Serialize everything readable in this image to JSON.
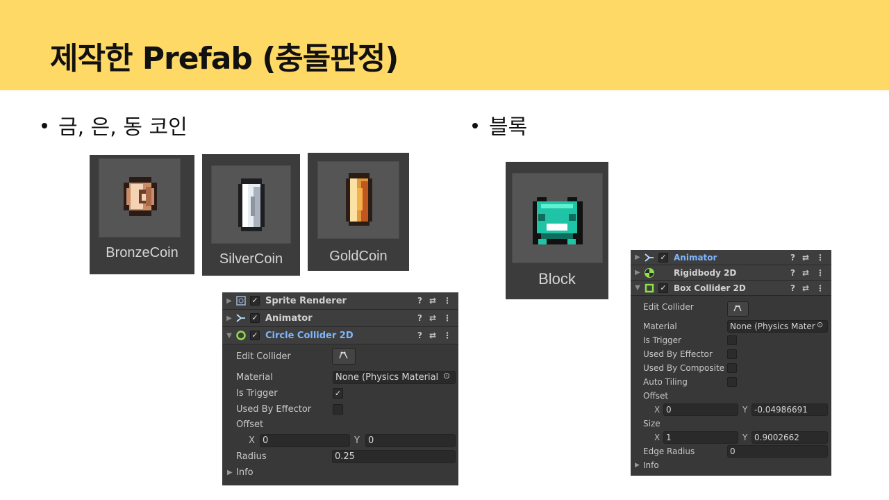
{
  "slide": {
    "title": "제작한 Prefab (충돌판정)",
    "bullet_coins": "금, 은, 동 코인",
    "bullet_block": "블록"
  },
  "prefabs": {
    "bronze": "BronzeCoin",
    "silver": "SilverCoin",
    "gold": "GoldCoin",
    "block": "Block"
  },
  "coin_inspector": {
    "components": [
      {
        "name": "Sprite Renderer",
        "icon": "sprite-renderer-icon",
        "enabled": true,
        "expanded": false
      },
      {
        "name": "Animator",
        "icon": "animator-icon",
        "enabled": true,
        "expanded": false
      },
      {
        "name": "Circle Collider 2D",
        "icon": "circle-collider-icon",
        "enabled": true,
        "expanded": true
      }
    ],
    "tools": [
      "?",
      "⇄",
      "⋮"
    ],
    "edit_collider_label": "Edit Collider",
    "material_label": "Material",
    "material_value": "None (Physics Material",
    "is_trigger_label": "Is Trigger",
    "is_trigger_value": "✓",
    "used_by_effector_label": "Used By Effector",
    "offset_label": "Offset",
    "x_label": "X",
    "y_label": "Y",
    "offset_x": "0",
    "offset_y": "0",
    "radius_label": "Radius",
    "radius_value": "0.25",
    "info_label": "Info"
  },
  "block_inspector": {
    "components": [
      {
        "name": "Animator",
        "icon": "animator-icon",
        "enabled": true,
        "expanded": false
      },
      {
        "name": "Rigidbody 2D",
        "icon": "rigidbody-icon",
        "enabled": null,
        "expanded": false
      },
      {
        "name": "Box Collider 2D",
        "icon": "box-collider-icon",
        "enabled": true,
        "expanded": true
      }
    ],
    "edit_collider_label": "Edit Collider",
    "material_label": "Material",
    "material_value": "None (Physics Mater",
    "is_trigger_label": "Is Trigger",
    "used_by_effector_label": "Used By Effector",
    "used_by_composite_label": "Used By Composite",
    "auto_tiling_label": "Auto Tiling",
    "offset_label": "Offset",
    "x_label": "X",
    "y_label": "Y",
    "offset_x": "0",
    "offset_y": "-0.04986691",
    "size_label": "Size",
    "size_x": "1",
    "size_y": "0.9002662",
    "edge_radius_label": "Edge Radius",
    "edge_radius_value": "0",
    "info_label": "Info"
  },
  "colors": {
    "header_bg": "#ffd966",
    "inspector_bg": "#383838",
    "selected_component": "#7db7ff",
    "collider_green": "#8ee04a"
  }
}
